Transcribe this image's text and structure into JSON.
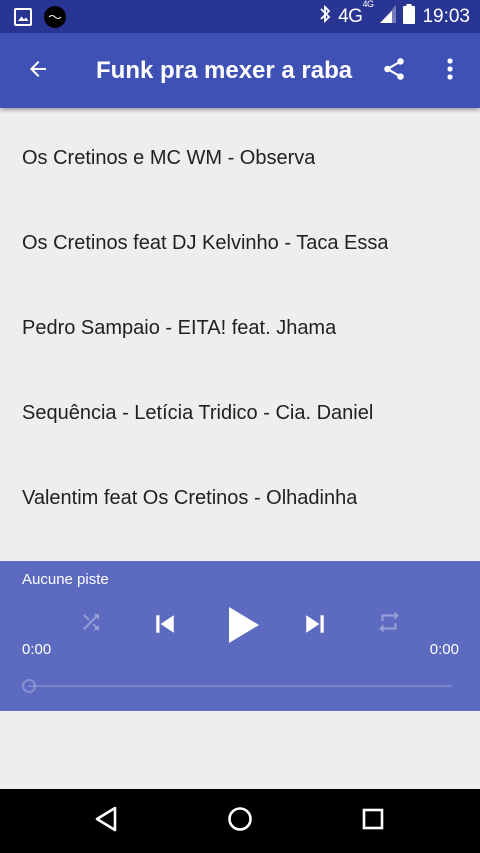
{
  "status_bar": {
    "network": "4G",
    "network_badge": "4G",
    "time": "19:03"
  },
  "app_bar": {
    "title": "Funk pra mexer a raba"
  },
  "tracks": [
    "Os Cretinos e MC WM - Observa",
    "Os Cretinos feat DJ Kelvinho - Taca Essa",
    "Pedro Sampaio - EITA! feat. Jhama",
    "Sequência - Letícia Tridico - Cia. Daniel",
    "Valentim feat Os Cretinos - Olhadinha"
  ],
  "player": {
    "now_playing": "Aucune piste",
    "elapsed": "0:00",
    "duration": "0:00",
    "progress": 0
  },
  "colors": {
    "status_bar": "#283593",
    "app_bar": "#3f51b5",
    "player": "#5c6bc0",
    "nav_bar": "#000000"
  },
  "icons": {
    "status_left": [
      "gallery-icon",
      "app-notification-icon"
    ],
    "status_right": [
      "bluetooth-icon",
      "signal-icon",
      "battery-icon"
    ],
    "app_bar": [
      "arrow-back-icon",
      "share-icon",
      "more-vert-icon"
    ],
    "player": [
      "shuffle-icon",
      "skip-previous-icon",
      "play-icon",
      "skip-next-icon",
      "repeat-icon"
    ],
    "nav": [
      "nav-back-icon",
      "nav-home-icon",
      "nav-recents-icon"
    ]
  }
}
